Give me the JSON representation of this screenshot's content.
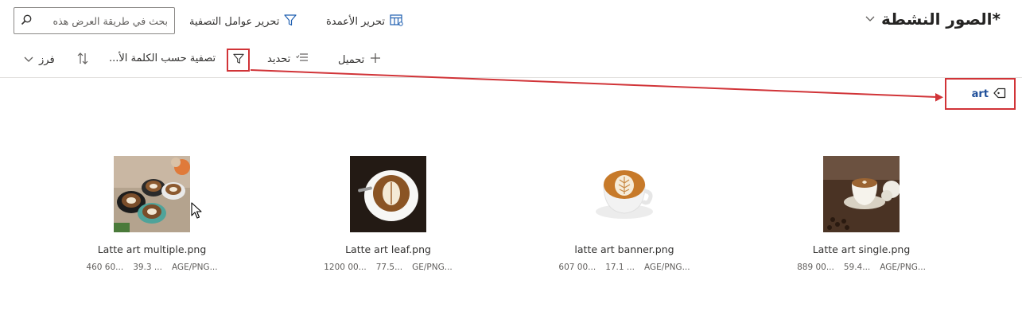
{
  "header": {
    "title": "*الصور النشطة",
    "edit_columns": "تحرير الأعمدة",
    "edit_filters": "تحرير عوامل التصفية",
    "search_placeholder": "بحث في طريقة العرض هذه"
  },
  "commands": {
    "upload": "تحميل",
    "select": "تحديد",
    "filter_by_keyword": "تصفية حسب الكلمة الأ...",
    "sort": "فرز"
  },
  "active_filter_tag": "art",
  "files": [
    {
      "name": "Latte art multiple.png",
      "meta": [
        "...AGE/PNG",
        "... 39.3",
        "...60 460"
      ],
      "icon": "latte-multiple-image"
    },
    {
      "name": "Latte art leaf.png",
      "meta": [
        "...GE/PNG",
        "...77.5",
        "...00 1200"
      ],
      "icon": "latte-leaf-image"
    },
    {
      "name": "latte art banner.png",
      "meta": [
        "...AGE/PNG",
        "... 17.1",
        "...00 607"
      ],
      "icon": "latte-banner-image"
    },
    {
      "name": "Latte art single.png",
      "meta": [
        "...AGE/PNG",
        "...59.4",
        "...00 889"
      ],
      "icon": "latte-single-image"
    }
  ],
  "colors": {
    "annotation_red": "#d13438",
    "tag_text": "#1f4f9a"
  }
}
